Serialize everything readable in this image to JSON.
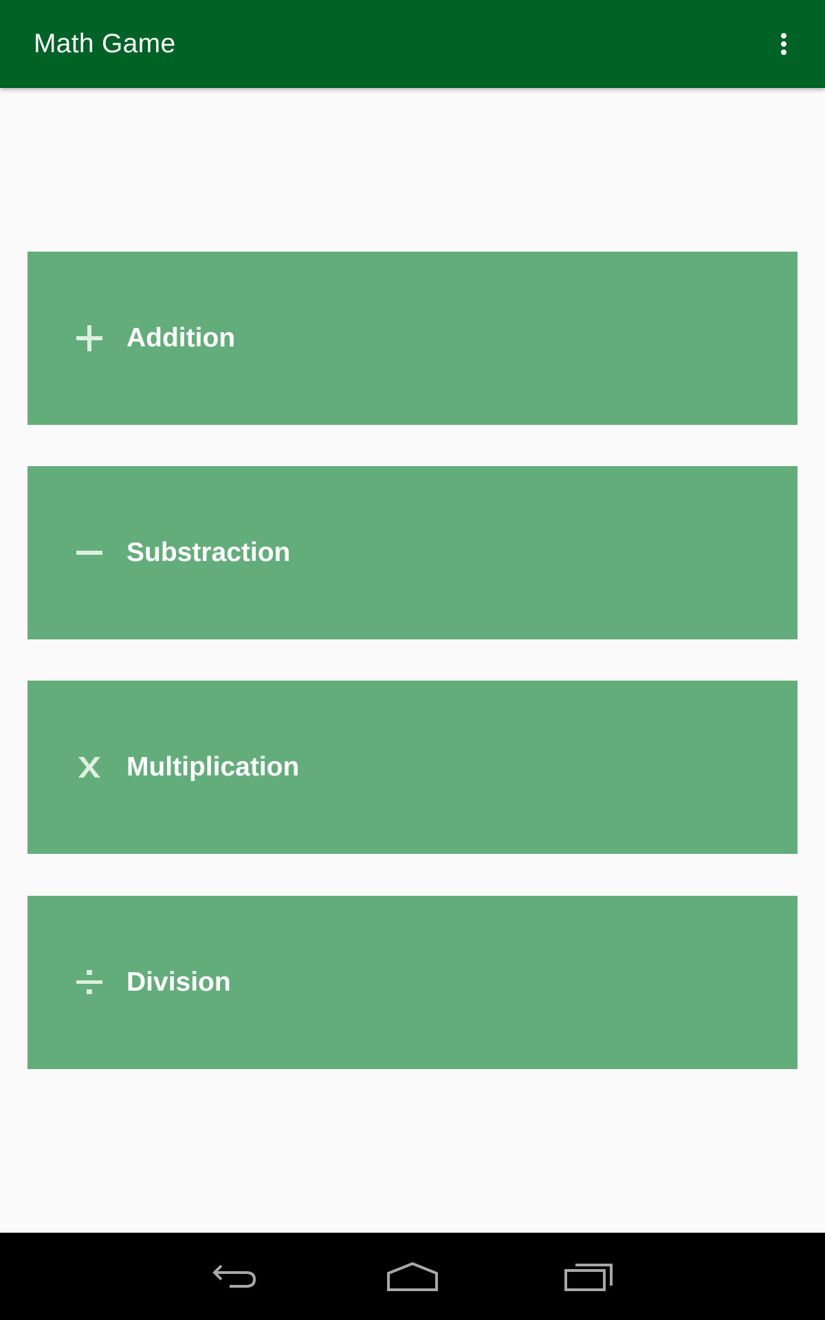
{
  "app_bar": {
    "title": "Math Game",
    "overflow_icon": "more-vert-icon",
    "background_color": "#006325"
  },
  "operations": [
    {
      "label": "Addition",
      "icon": "plus-icon",
      "symbol": "+"
    },
    {
      "label": "Substraction",
      "icon": "minus-icon",
      "symbol": "−"
    },
    {
      "label": "Multiplication",
      "icon": "multiply-icon",
      "symbol": "X"
    },
    {
      "label": "Division",
      "icon": "divide-icon",
      "symbol": "÷"
    }
  ],
  "card_color": "#63ad7b",
  "nav_bar": {
    "buttons": [
      {
        "name": "back",
        "icon": "back-icon"
      },
      {
        "name": "home",
        "icon": "home-icon"
      },
      {
        "name": "recents",
        "icon": "recents-icon"
      }
    ]
  }
}
